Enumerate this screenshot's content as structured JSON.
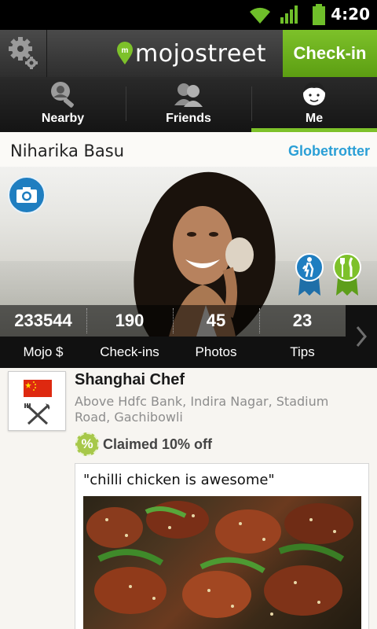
{
  "status_bar": {
    "time": "4:20",
    "icons": [
      "wifi-icon",
      "signal-icon",
      "battery-icon"
    ]
  },
  "header": {
    "logo_text": "mojostreet",
    "checkin_label": "Check-in",
    "settings_icon": "gear-icon"
  },
  "tabs": [
    {
      "label": "Nearby",
      "icon": "nearby-search-icon",
      "active": false
    },
    {
      "label": "Friends",
      "icon": "friends-icon",
      "active": false
    },
    {
      "label": "Me",
      "icon": "me-face-icon",
      "active": true
    }
  ],
  "profile": {
    "name": "Niharika Basu",
    "level": "Globetrotter",
    "badges": [
      "hiker-badge-icon",
      "food-badge-icon"
    ]
  },
  "stats": [
    {
      "value": "233544",
      "label": "Mojo $"
    },
    {
      "value": "190",
      "label": "Check-ins"
    },
    {
      "value": "45",
      "label": "Photos"
    },
    {
      "value": "23",
      "label": "Tips"
    }
  ],
  "checkin": {
    "venue_name": "Shanghai Chef",
    "venue_address": "Above Hdfc Bank, Indira Nagar, Stadium Road, Gachibowli",
    "offer_icon": "%",
    "offer_text": "Claimed 10% off",
    "tip_text": "\"chilli chicken is awesome\""
  },
  "colors": {
    "accent_green": "#7dc12a",
    "link_blue": "#2a9fd6",
    "camera_blue": "#1f7ec0"
  }
}
